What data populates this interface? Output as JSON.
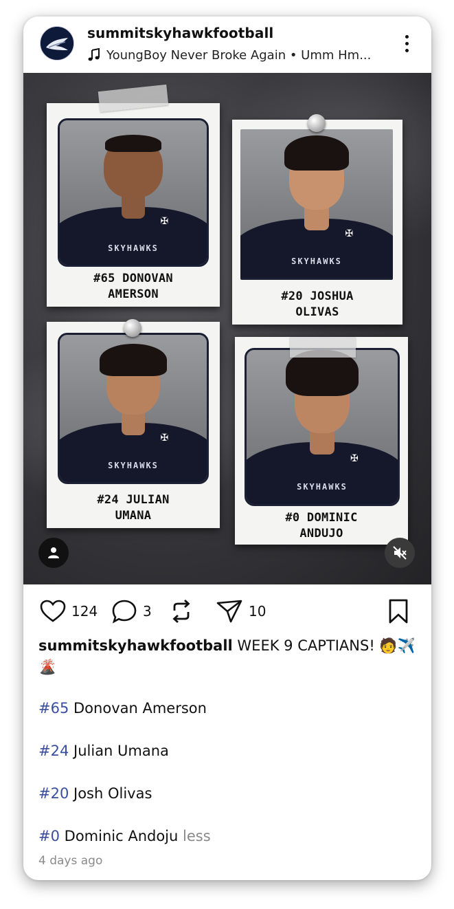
{
  "post": {
    "username": "summitskyhawkfootball",
    "music": "YoungBoy Never Broke Again • Umm Hm...",
    "players": [
      {
        "caption_l1": "#65 DONOVAN",
        "caption_l2": "AMERSON",
        "team": "SKYHAWKS"
      },
      {
        "caption_l1": "#20 JOSHUA",
        "caption_l2": "OLIVAS",
        "team": "SKYHAWKS"
      },
      {
        "caption_l1": "#24 JULIAN",
        "caption_l2": "UMANA",
        "team": "SKYHAWKS"
      },
      {
        "caption_l1": "#0 DOMINIC",
        "caption_l2": "ANDUJO",
        "team": "SKYHAWKS"
      }
    ],
    "actions": {
      "likes": "124",
      "comments": "3",
      "shares": "10"
    },
    "caption": {
      "username": "summitskyhawkfootball",
      "text": "WEEK 9 CAPTIANS! 🧑✈️🌋"
    },
    "tags": [
      {
        "tag": "#65",
        "name": "Donovan Amerson"
      },
      {
        "tag": "#24",
        "name": "Julian Umana"
      },
      {
        "tag": "#20",
        "name": "Josh Olivas"
      },
      {
        "tag": "#0",
        "name": "Dominic Andoju"
      }
    ],
    "less_label": "less",
    "timestamp": "4 days ago"
  },
  "colors": {
    "hashtag": "#3a4ea0",
    "muted": "#8a8a8a",
    "jersey": "#15172a"
  },
  "icons": [
    "eagle-logo-icon",
    "music-note-icon",
    "more-icon",
    "heart-icon",
    "comment-icon",
    "repost-icon",
    "send-icon",
    "bookmark-icon",
    "user-icon",
    "mute-icon"
  ]
}
